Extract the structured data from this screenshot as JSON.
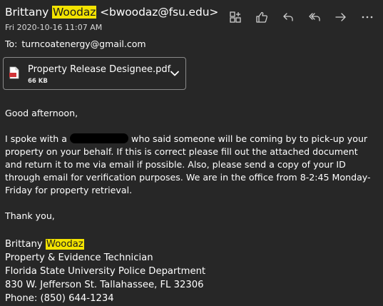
{
  "header": {
    "sender_first": "Brittany",
    "sender_last": "Woodaz",
    "sender_email": "<bwoodaz@fsu.edu>",
    "date": "Fri 2020-10-16 11:07 AM",
    "to_label": "To:",
    "to_address": "turncoatenergy@gmail.com",
    "highlight_color": "#f3e300"
  },
  "toolbar": {
    "icons": [
      "add-in-icon",
      "like-icon",
      "reply-icon",
      "reply-all-icon",
      "forward-icon",
      "more-icon"
    ]
  },
  "attachment": {
    "name": "Property Release Designee.pdf",
    "size": "66 KB",
    "icon": "pdf-file-icon",
    "accent_color": "#d13438"
  },
  "message": {
    "greeting": "Good afternoon,",
    "para_part1": "I spoke with a",
    "para_part2": "who said someone will be coming by to pick-up your property on your behalf. If this is correct please fill out the attached document and return it to me via email if possible. Also, please send a copy of your ID through email for verification purposes. We are in the office from 8-2:45 Monday-Friday for property retrieval.",
    "closing": "Thank you,"
  },
  "signature": {
    "first": "Brittany",
    "last": "Woodaz",
    "title": "Property & Evidence Technician",
    "org": "Florida State University Police Department",
    "address": "830 W. Jefferson St. Tallahassee, FL 32306",
    "phone": "Phone: (850) 644-1234"
  }
}
